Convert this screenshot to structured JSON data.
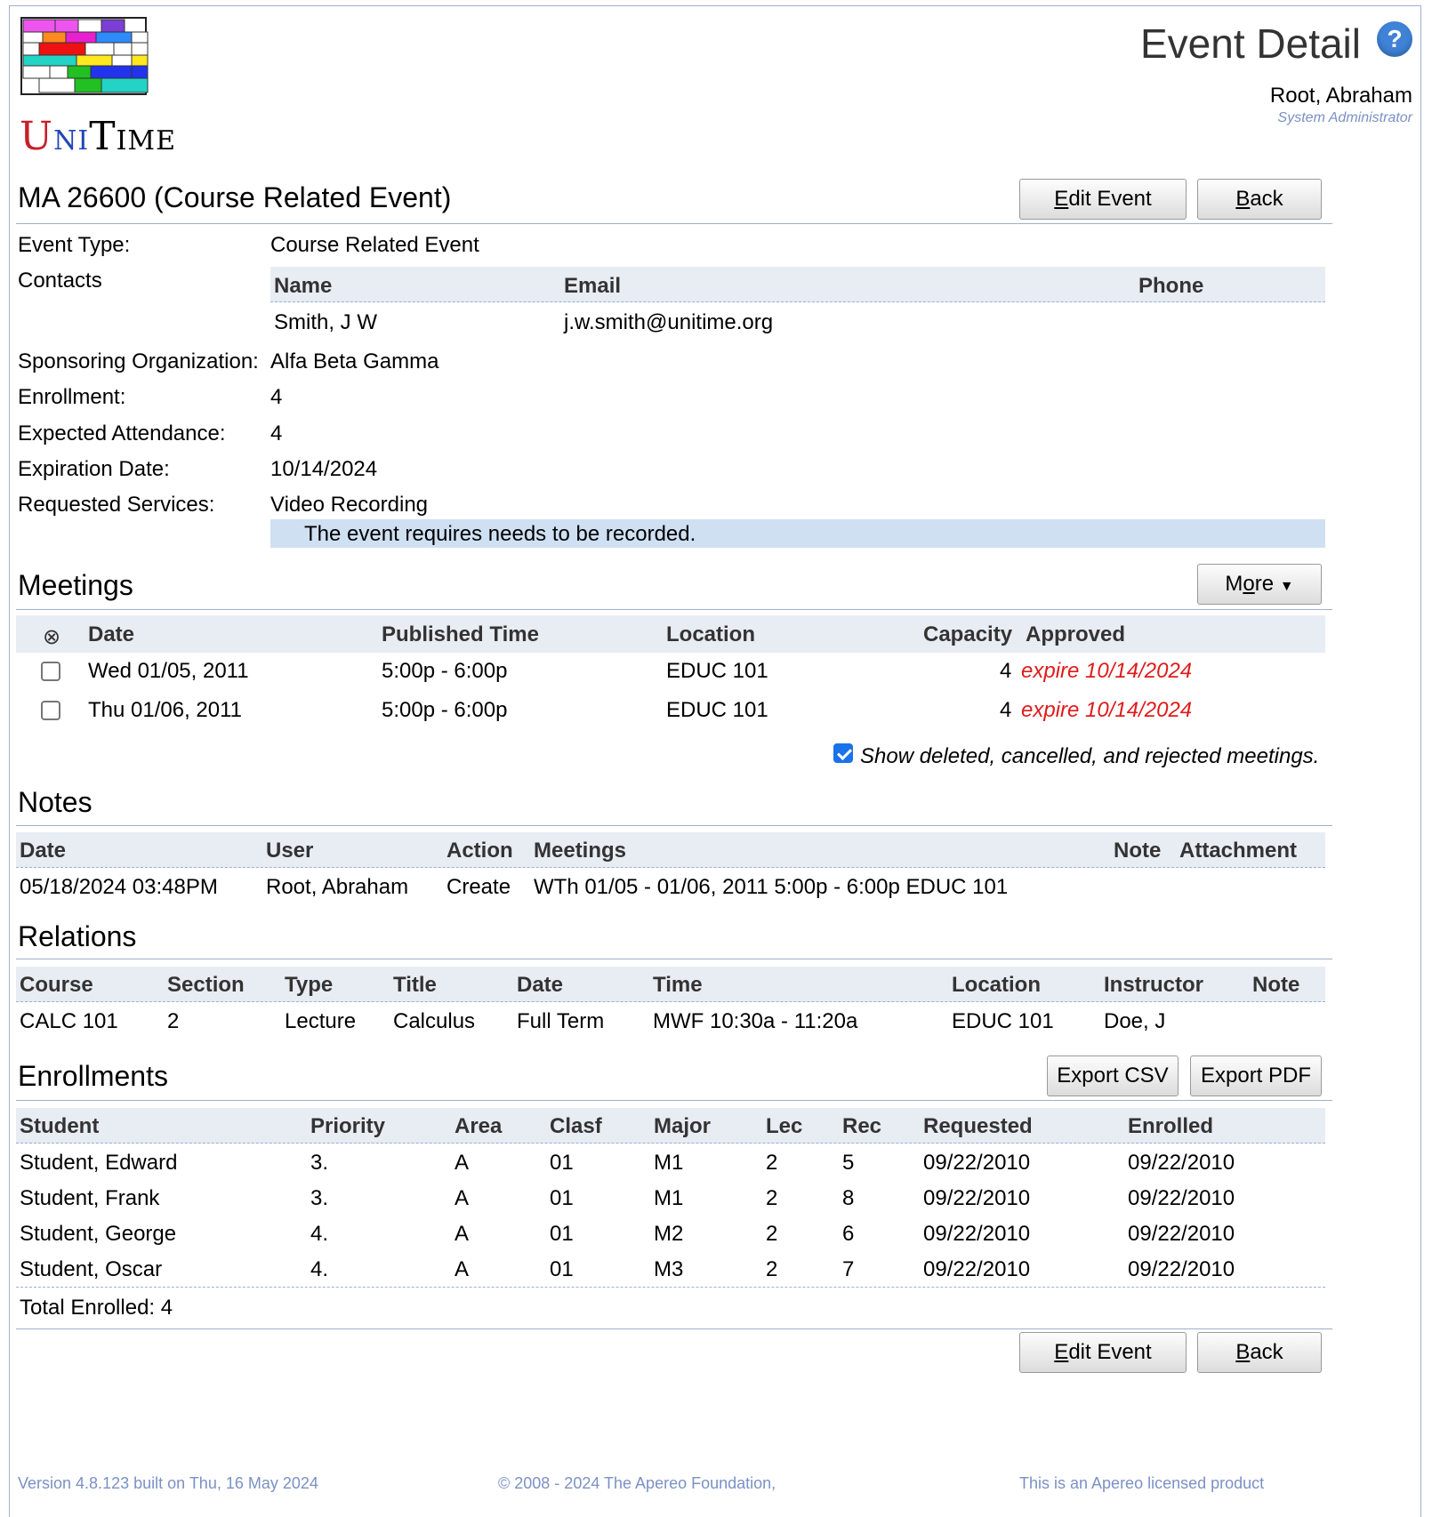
{
  "app": {
    "logo_text": "UniTime",
    "page_title": "Event Detail",
    "help_icon": "question-mark-icon",
    "user_name": "Root, Abraham",
    "user_role": "System Administrator"
  },
  "event": {
    "title": "MA 26600 (Course Related Event)",
    "edit_label": "Edit Event",
    "back_label": "Back",
    "fields": {
      "event_type_label": "Event Type:",
      "event_type_value": "Course Related Event",
      "contacts_label": "Contacts",
      "sponsor_label": "Sponsoring Organization:",
      "sponsor_value": "Alfa Beta Gamma",
      "enrollment_label": "Enrollment:",
      "enrollment_value": "4",
      "attendance_label": "Expected Attendance:",
      "attendance_value": "4",
      "expiration_label": "Expiration Date:",
      "expiration_value": "10/14/2024",
      "services_label": "Requested Services:",
      "services_value": "Video Recording",
      "services_note": "The event requires needs to be recorded."
    },
    "contacts": {
      "headers": [
        "Name",
        "Email",
        "Phone"
      ],
      "rows": [
        [
          "Smith, J W",
          "j.w.smith@unitime.org",
          ""
        ]
      ]
    }
  },
  "meetings": {
    "title": "Meetings",
    "more_label": "More",
    "headers": {
      "select": "⊗",
      "date": "Date",
      "time": "Published Time",
      "location": "Location",
      "capacity": "Capacity",
      "approved": "Approved"
    },
    "rows": [
      {
        "date": "Wed 01/05, 2011",
        "time": "5:00p - 6:00p",
        "location": "EDUC 101",
        "capacity": "4",
        "approved": "expire 10/14/2024"
      },
      {
        "date": "Thu 01/06, 2011",
        "time": "5:00p - 6:00p",
        "location": "EDUC 101",
        "capacity": "4",
        "approved": "expire 10/14/2024"
      }
    ],
    "show_deleted_label": "Show deleted, cancelled, and rejected meetings.",
    "show_deleted_checked": true
  },
  "notes": {
    "title": "Notes",
    "headers": [
      "Date",
      "User",
      "Action",
      "Meetings",
      "Note",
      "Attachment"
    ],
    "rows": [
      [
        "05/18/2024 03:48PM",
        "Root, Abraham",
        "Create",
        "WTh 01/05 - 01/06, 2011 5:00p - 6:00p EDUC 101",
        "",
        ""
      ]
    ]
  },
  "relations": {
    "title": "Relations",
    "headers": [
      "Course",
      "Section",
      "Type",
      "Title",
      "Date",
      "Time",
      "Location",
      "Instructor",
      "Note"
    ],
    "rows": [
      [
        "CALC 101",
        "2",
        "Lecture",
        "Calculus",
        "Full Term",
        "MWF 10:30a - 11:20a",
        "EDUC 101",
        "Doe, J",
        ""
      ]
    ]
  },
  "enrollments": {
    "title": "Enrollments",
    "export_csv_label": "Export CSV",
    "export_pdf_label": "Export PDF",
    "headers": [
      "Student",
      "Priority",
      "Area",
      "Clasf",
      "Major",
      "Lec",
      "Rec",
      "Requested",
      "Enrolled"
    ],
    "rows": [
      [
        "Student, Edward",
        "3.",
        "A",
        "01",
        "M1",
        "2",
        "5",
        "09/22/2010",
        "09/22/2010"
      ],
      [
        "Student, Frank",
        "3.",
        "A",
        "01",
        "M1",
        "2",
        "8",
        "09/22/2010",
        "09/22/2010"
      ],
      [
        "Student, George",
        "4.",
        "A",
        "01",
        "M2",
        "2",
        "6",
        "09/22/2010",
        "09/22/2010"
      ],
      [
        "Student, Oscar",
        "4.",
        "A",
        "01",
        "M3",
        "2",
        "7",
        "09/22/2010",
        "09/22/2010"
      ]
    ],
    "total": "Total Enrolled: 4"
  },
  "footer": {
    "version": "Version 4.8.123 built on Thu, 16 May 2024",
    "copyright": "© 2008 - 2024 The Apereo Foundation,",
    "license": "This is an Apereo licensed product"
  }
}
